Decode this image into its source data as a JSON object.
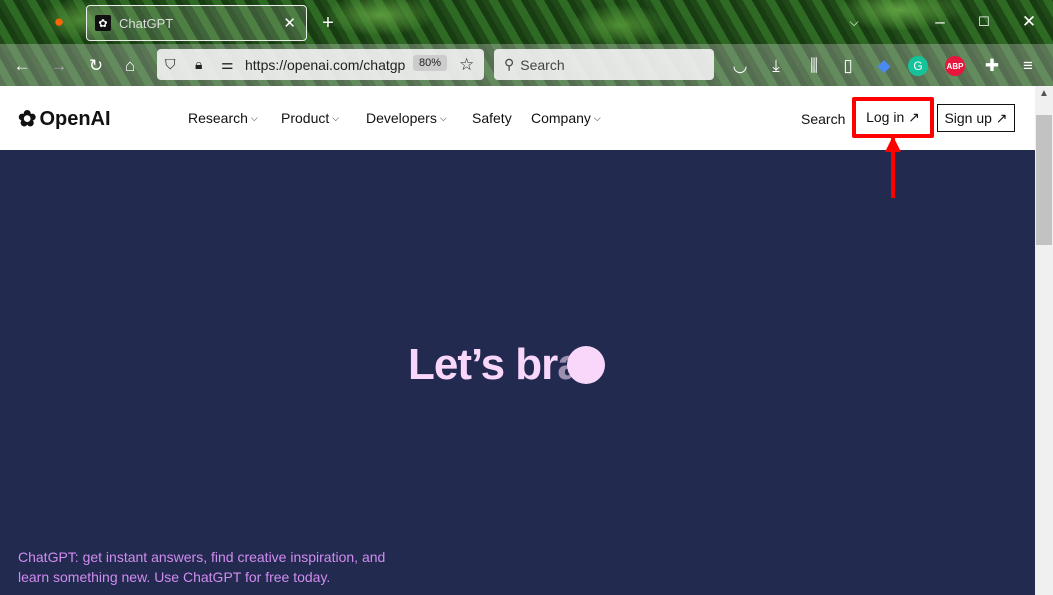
{
  "browser": {
    "tab_title": "ChatGPT",
    "url": "https://openai.com/chatgp",
    "zoom": "80%",
    "search_placeholder": "Search",
    "adblock_label": "ABP"
  },
  "nav": {
    "logo": "OpenAI",
    "items": [
      {
        "label": "Research"
      },
      {
        "label": "Product"
      },
      {
        "label": "Developers"
      },
      {
        "label": "Safety"
      },
      {
        "label": "Company"
      }
    ],
    "search": "Search",
    "login": "Log in ↗",
    "signup": "Sign up ↗"
  },
  "hero": {
    "headline_main": "Let’s br",
    "headline_faded": "a"
  },
  "tagline": "ChatGPT: get instant answers, find creative inspiration, and learn something new. Use ChatGPT for free today.",
  "colors": {
    "hero_bg": "#222a4f",
    "headline": "#f9d7fb",
    "tagline": "#d18cf0",
    "highlight": "#ff0000"
  }
}
